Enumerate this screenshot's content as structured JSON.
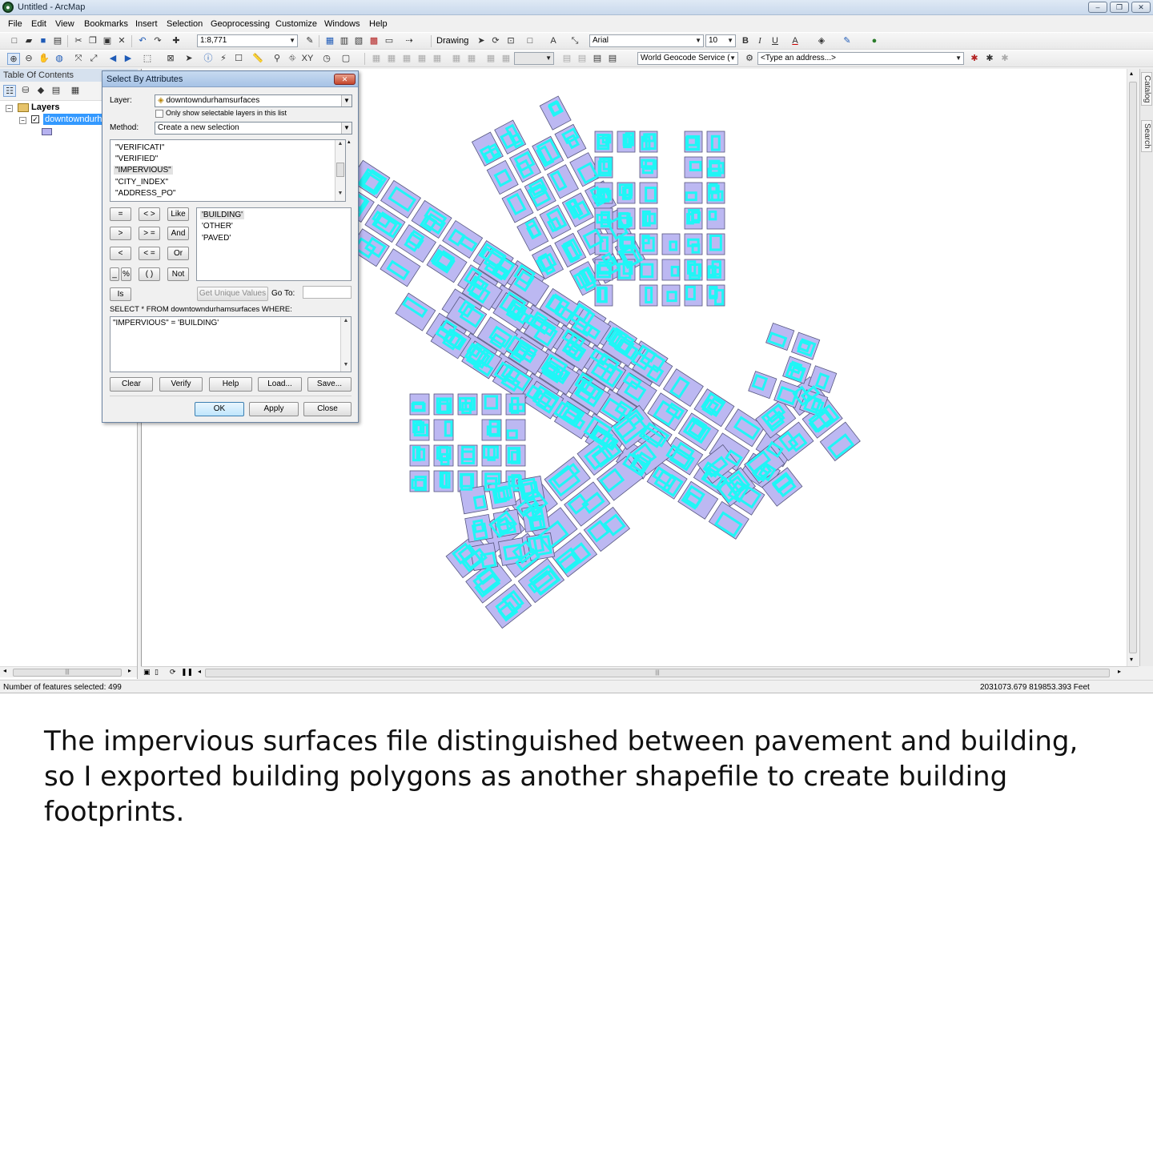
{
  "window": {
    "title": "Untitled - ArcMap",
    "min_glyph": "‒",
    "max_glyph": "❐",
    "close_glyph": "✕"
  },
  "menu": [
    "File",
    "Edit",
    "View",
    "Bookmarks",
    "Insert",
    "Selection",
    "Geoprocessing",
    "Customize",
    "Windows",
    "Help"
  ],
  "toolbar": {
    "scale": "1:8,771",
    "drawing_label": "Drawing",
    "font_name": "Arial",
    "font_size": "10",
    "bold": "B",
    "italic": "I",
    "underline": "U",
    "geocode_service": "World Geocode Service (",
    "address_placeholder": "<Type an address...>"
  },
  "toc": {
    "title": "Table Of Contents",
    "root": "Layers",
    "layer": "downtowndurhamsurfaces",
    "checked": "✓",
    "collapse": "−"
  },
  "side_tabs": [
    "Catalog",
    "Search"
  ],
  "dialog": {
    "title": "Select By Attributes",
    "close_glyph": "✕",
    "layer_label": "Layer:",
    "layer_value": "downtowndurhamsurfaces",
    "only_selectable": "Only show selectable layers in this list",
    "method_label": "Method:",
    "method_value": "Create a new selection",
    "fields": [
      "\"VERIFICATI\"",
      "\"VERIFIED\"",
      "\"IMPERVIOUS\"",
      "\"CITY_INDEX\"",
      "\"ADDRESS_PO\""
    ],
    "selected_field_index": 2,
    "operators": [
      "=",
      "< >",
      "Like",
      ">",
      "> =",
      "And",
      "<",
      "< =",
      "Or",
      "_",
      "%",
      "( )",
      "Not",
      "Is"
    ],
    "values": [
      "'BUILDING'",
      "'OTHER'",
      "'PAVED'"
    ],
    "unique_values_label": "Get Unique Values",
    "goto_label": "Go To:",
    "sql_label": "SELECT * FROM downtowndurhamsurfaces WHERE:",
    "sql_expression": "\"IMPERVIOUS\" = 'BUILDING'",
    "buttons": [
      "Clear",
      "Verify",
      "Help",
      "Load...",
      "Save..."
    ],
    "ok": "OK",
    "apply": "Apply",
    "close": "Close"
  },
  "status": {
    "selected": "Number of features selected: 499",
    "coords": "2031073.679  819853.393 Feet"
  },
  "caption": "The impervious surfaces file distinguished between pavement and building, so I exported building polygons as another shapefile to create building footprints.",
  "colors": {
    "polygon_fill": "#bcb8f2",
    "polygon_outline": "#57577f",
    "selection": "#1ff6f6",
    "layer_highlight": "#3399ff"
  }
}
